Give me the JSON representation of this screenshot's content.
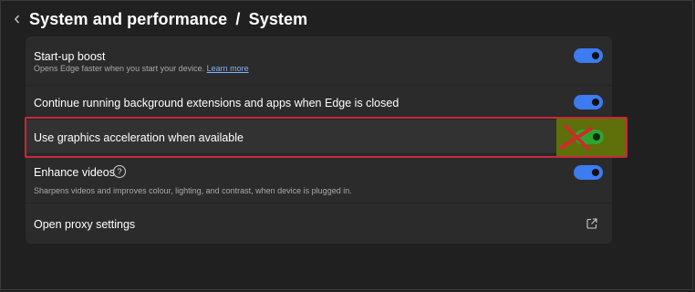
{
  "header": {
    "section": "System and performance",
    "separator": "/",
    "page": "System"
  },
  "settings": [
    {
      "label": "Start-up boost",
      "description": "Opens Edge faster when you start your device.",
      "link": "Learn more",
      "toggle": "on"
    },
    {
      "label": "Continue running background extensions and apps when Edge is closed",
      "toggle": "on"
    },
    {
      "label": "Use graphics acceleration when available",
      "toggle": "on"
    },
    {
      "label": "Enhance videos",
      "help_icon": "?",
      "description": "Sharpens videos and improves colour, lighting, and contrast, when device is plugged in.",
      "toggle": "on"
    },
    {
      "label": "Open proxy settings",
      "icon": "external-link-icon"
    }
  ],
  "colors": {
    "toggle_on": "#3d7bf0",
    "highlight_border": "#c8283a",
    "highlight_fill": "#5f6f0a",
    "cross_mark": "#d02a2a",
    "toggle_highlighted": "#2fa52f"
  }
}
